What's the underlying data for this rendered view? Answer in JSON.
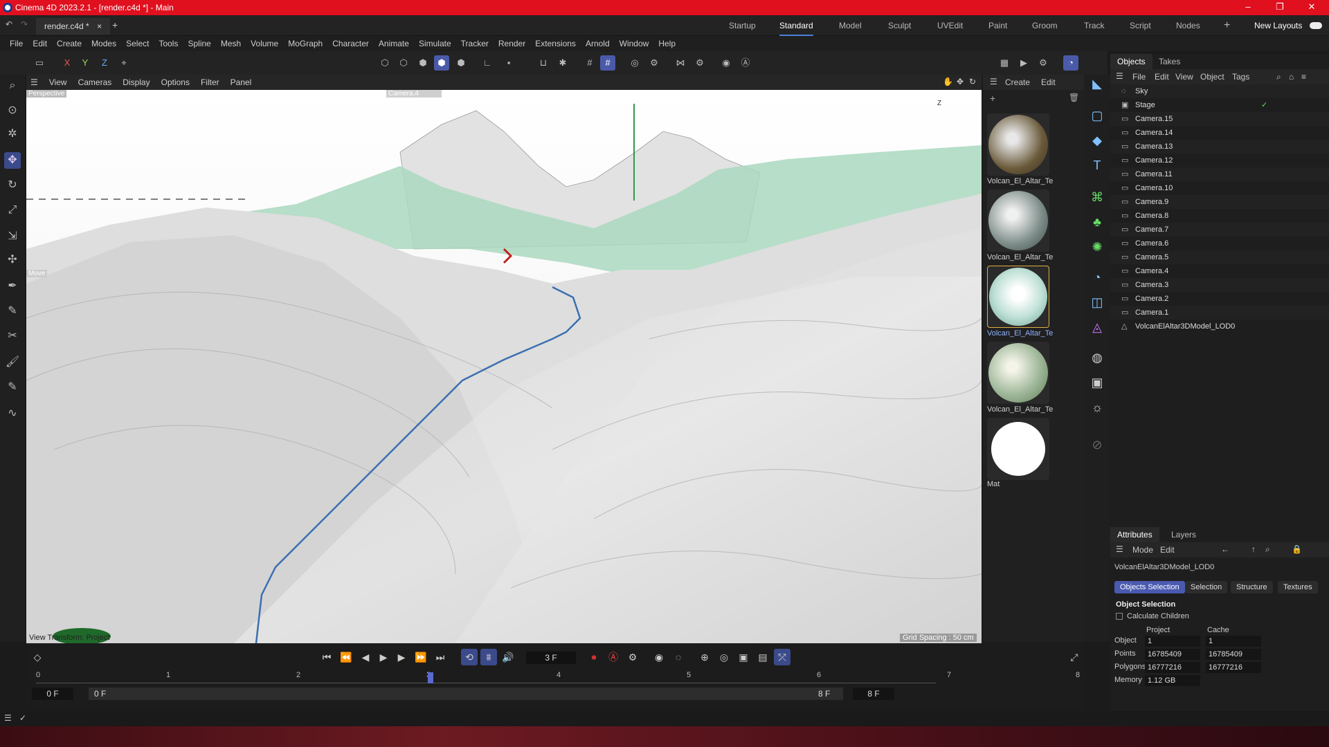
{
  "window": {
    "title": "Cinema 4D 2023.2.1 - [render.c4d *] - Main"
  },
  "doc_tab": {
    "label": "render.c4d *"
  },
  "layouts": [
    {
      "label": "Startup"
    },
    {
      "label": "Standard"
    },
    {
      "label": "Model"
    },
    {
      "label": "Sculpt"
    },
    {
      "label": "UVEdit"
    },
    {
      "label": "Paint"
    },
    {
      "label": "Groom"
    },
    {
      "label": "Track"
    },
    {
      "label": "Script"
    },
    {
      "label": "Nodes"
    }
  ],
  "new_layouts": "New Layouts",
  "menu": [
    "File",
    "Edit",
    "Create",
    "Modes",
    "Select",
    "Tools",
    "Spline",
    "Mesh",
    "Volume",
    "MoGraph",
    "Character",
    "Animate",
    "Simulate",
    "Tracker",
    "Render",
    "Extensions",
    "Arnold",
    "Window",
    "Help"
  ],
  "axes": {
    "x": "X",
    "y": "Y",
    "z": "Z"
  },
  "viewport": {
    "menu": [
      "View",
      "Cameras",
      "Display",
      "Options",
      "Filter",
      "Panel"
    ],
    "mode": "Perspective",
    "camera": "Camera.4",
    "tool": "Move",
    "view_transform": "View Transform: Project",
    "grid_spacing": "Grid Spacing : 50 cm",
    "axis_z": "Z"
  },
  "materials": {
    "menu": [
      "Create",
      "Edit"
    ],
    "items": [
      {
        "name": "Volcan_El_Altar_Te",
        "color": "#6a5a3a"
      },
      {
        "name": "Volcan_El_Altar_Te",
        "color": "#7a8a86"
      },
      {
        "name": "Volcan_El_Altar_Te",
        "color": "#bfe0d6"
      },
      {
        "name": "Volcan_El_Altar_Te",
        "color": "#9fb89a"
      },
      {
        "name": "Mat",
        "color": "#ffffff"
      }
    ]
  },
  "objects": {
    "tabs": [
      "Objects",
      "Takes"
    ],
    "menu": [
      "File",
      "Edit",
      "View",
      "Object",
      "Tags"
    ],
    "items": [
      {
        "name": "Sky"
      },
      {
        "name": "Stage"
      },
      {
        "name": "Camera.15"
      },
      {
        "name": "Camera.14"
      },
      {
        "name": "Camera.13"
      },
      {
        "name": "Camera.12"
      },
      {
        "name": "Camera.11"
      },
      {
        "name": "Camera.10"
      },
      {
        "name": "Camera.9"
      },
      {
        "name": "Camera.8"
      },
      {
        "name": "Camera.7"
      },
      {
        "name": "Camera.6"
      },
      {
        "name": "Camera.5"
      },
      {
        "name": "Camera.4"
      },
      {
        "name": "Camera.3"
      },
      {
        "name": "Camera.2"
      },
      {
        "name": "Camera.1"
      },
      {
        "name": "VolcanElAltar3DModel_LOD0"
      }
    ]
  },
  "attributes": {
    "tabs": [
      "Attributes",
      "Layers"
    ],
    "menu": [
      "Mode",
      "Edit"
    ],
    "object_name": "VolcanElAltar3DModel_LOD0",
    "buttons": [
      "Objects Selection",
      "Selection",
      "Structure",
      "Textures"
    ],
    "section": "Object Selection",
    "calc_children": "Calculate Children",
    "col_project": "Project",
    "col_cache": "Cache",
    "rows": [
      {
        "label": "Object",
        "project": "1",
        "cache": "1"
      },
      {
        "label": "Points",
        "project": "16785409",
        "cache": "16785409"
      },
      {
        "label": "Polygons",
        "project": "16777216",
        "cache": "16777216"
      },
      {
        "label": "Memory",
        "project": "1.12 GB",
        "cache": ""
      }
    ]
  },
  "timeline": {
    "current_frame": "3 F",
    "ticks": [
      "0",
      "1",
      "2",
      "3",
      "4",
      "5",
      "6",
      "7",
      "8"
    ],
    "start": "0 F",
    "min": "0 F",
    "max": "8 F",
    "end": "8 F"
  }
}
